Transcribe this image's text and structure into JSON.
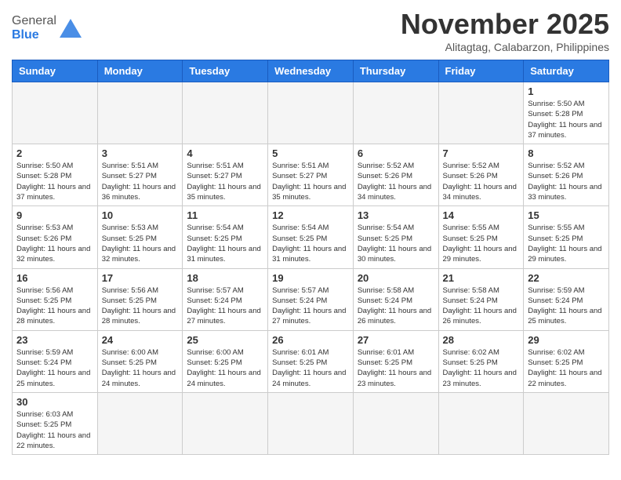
{
  "header": {
    "logo_general": "General",
    "logo_blue": "Blue",
    "month_title": "November 2025",
    "location": "Alitagtag, Calabarzon, Philippines"
  },
  "weekdays": [
    "Sunday",
    "Monday",
    "Tuesday",
    "Wednesday",
    "Thursday",
    "Friday",
    "Saturday"
  ],
  "days": [
    {
      "num": "",
      "info": "",
      "empty": true
    },
    {
      "num": "",
      "info": "",
      "empty": true
    },
    {
      "num": "",
      "info": "",
      "empty": true
    },
    {
      "num": "",
      "info": "",
      "empty": true
    },
    {
      "num": "",
      "info": "",
      "empty": true
    },
    {
      "num": "",
      "info": "",
      "empty": true
    },
    {
      "num": "1",
      "info": "Sunrise: 5:50 AM\nSunset: 5:28 PM\nDaylight: 11 hours and 37 minutes.",
      "empty": false
    },
    {
      "num": "2",
      "info": "Sunrise: 5:50 AM\nSunset: 5:28 PM\nDaylight: 11 hours and 37 minutes.",
      "empty": false
    },
    {
      "num": "3",
      "info": "Sunrise: 5:51 AM\nSunset: 5:27 PM\nDaylight: 11 hours and 36 minutes.",
      "empty": false
    },
    {
      "num": "4",
      "info": "Sunrise: 5:51 AM\nSunset: 5:27 PM\nDaylight: 11 hours and 35 minutes.",
      "empty": false
    },
    {
      "num": "5",
      "info": "Sunrise: 5:51 AM\nSunset: 5:27 PM\nDaylight: 11 hours and 35 minutes.",
      "empty": false
    },
    {
      "num": "6",
      "info": "Sunrise: 5:52 AM\nSunset: 5:26 PM\nDaylight: 11 hours and 34 minutes.",
      "empty": false
    },
    {
      "num": "7",
      "info": "Sunrise: 5:52 AM\nSunset: 5:26 PM\nDaylight: 11 hours and 34 minutes.",
      "empty": false
    },
    {
      "num": "8",
      "info": "Sunrise: 5:52 AM\nSunset: 5:26 PM\nDaylight: 11 hours and 33 minutes.",
      "empty": false
    },
    {
      "num": "9",
      "info": "Sunrise: 5:53 AM\nSunset: 5:26 PM\nDaylight: 11 hours and 32 minutes.",
      "empty": false
    },
    {
      "num": "10",
      "info": "Sunrise: 5:53 AM\nSunset: 5:25 PM\nDaylight: 11 hours and 32 minutes.",
      "empty": false
    },
    {
      "num": "11",
      "info": "Sunrise: 5:54 AM\nSunset: 5:25 PM\nDaylight: 11 hours and 31 minutes.",
      "empty": false
    },
    {
      "num": "12",
      "info": "Sunrise: 5:54 AM\nSunset: 5:25 PM\nDaylight: 11 hours and 31 minutes.",
      "empty": false
    },
    {
      "num": "13",
      "info": "Sunrise: 5:54 AM\nSunset: 5:25 PM\nDaylight: 11 hours and 30 minutes.",
      "empty": false
    },
    {
      "num": "14",
      "info": "Sunrise: 5:55 AM\nSunset: 5:25 PM\nDaylight: 11 hours and 29 minutes.",
      "empty": false
    },
    {
      "num": "15",
      "info": "Sunrise: 5:55 AM\nSunset: 5:25 PM\nDaylight: 11 hours and 29 minutes.",
      "empty": false
    },
    {
      "num": "16",
      "info": "Sunrise: 5:56 AM\nSunset: 5:25 PM\nDaylight: 11 hours and 28 minutes.",
      "empty": false
    },
    {
      "num": "17",
      "info": "Sunrise: 5:56 AM\nSunset: 5:25 PM\nDaylight: 11 hours and 28 minutes.",
      "empty": false
    },
    {
      "num": "18",
      "info": "Sunrise: 5:57 AM\nSunset: 5:24 PM\nDaylight: 11 hours and 27 minutes.",
      "empty": false
    },
    {
      "num": "19",
      "info": "Sunrise: 5:57 AM\nSunset: 5:24 PM\nDaylight: 11 hours and 27 minutes.",
      "empty": false
    },
    {
      "num": "20",
      "info": "Sunrise: 5:58 AM\nSunset: 5:24 PM\nDaylight: 11 hours and 26 minutes.",
      "empty": false
    },
    {
      "num": "21",
      "info": "Sunrise: 5:58 AM\nSunset: 5:24 PM\nDaylight: 11 hours and 26 minutes.",
      "empty": false
    },
    {
      "num": "22",
      "info": "Sunrise: 5:59 AM\nSunset: 5:24 PM\nDaylight: 11 hours and 25 minutes.",
      "empty": false
    },
    {
      "num": "23",
      "info": "Sunrise: 5:59 AM\nSunset: 5:24 PM\nDaylight: 11 hours and 25 minutes.",
      "empty": false
    },
    {
      "num": "24",
      "info": "Sunrise: 6:00 AM\nSunset: 5:25 PM\nDaylight: 11 hours and 24 minutes.",
      "empty": false
    },
    {
      "num": "25",
      "info": "Sunrise: 6:00 AM\nSunset: 5:25 PM\nDaylight: 11 hours and 24 minutes.",
      "empty": false
    },
    {
      "num": "26",
      "info": "Sunrise: 6:01 AM\nSunset: 5:25 PM\nDaylight: 11 hours and 24 minutes.",
      "empty": false
    },
    {
      "num": "27",
      "info": "Sunrise: 6:01 AM\nSunset: 5:25 PM\nDaylight: 11 hours and 23 minutes.",
      "empty": false
    },
    {
      "num": "28",
      "info": "Sunrise: 6:02 AM\nSunset: 5:25 PM\nDaylight: 11 hours and 23 minutes.",
      "empty": false
    },
    {
      "num": "29",
      "info": "Sunrise: 6:02 AM\nSunset: 5:25 PM\nDaylight: 11 hours and 22 minutes.",
      "empty": false
    },
    {
      "num": "30",
      "info": "Sunrise: 6:03 AM\nSunset: 5:25 PM\nDaylight: 11 hours and 22 minutes.",
      "empty": false
    },
    {
      "num": "",
      "info": "",
      "empty": true
    },
    {
      "num": "",
      "info": "",
      "empty": true
    },
    {
      "num": "",
      "info": "",
      "empty": true
    },
    {
      "num": "",
      "info": "",
      "empty": true
    },
    {
      "num": "",
      "info": "",
      "empty": true
    },
    {
      "num": "",
      "info": "",
      "empty": true
    }
  ]
}
